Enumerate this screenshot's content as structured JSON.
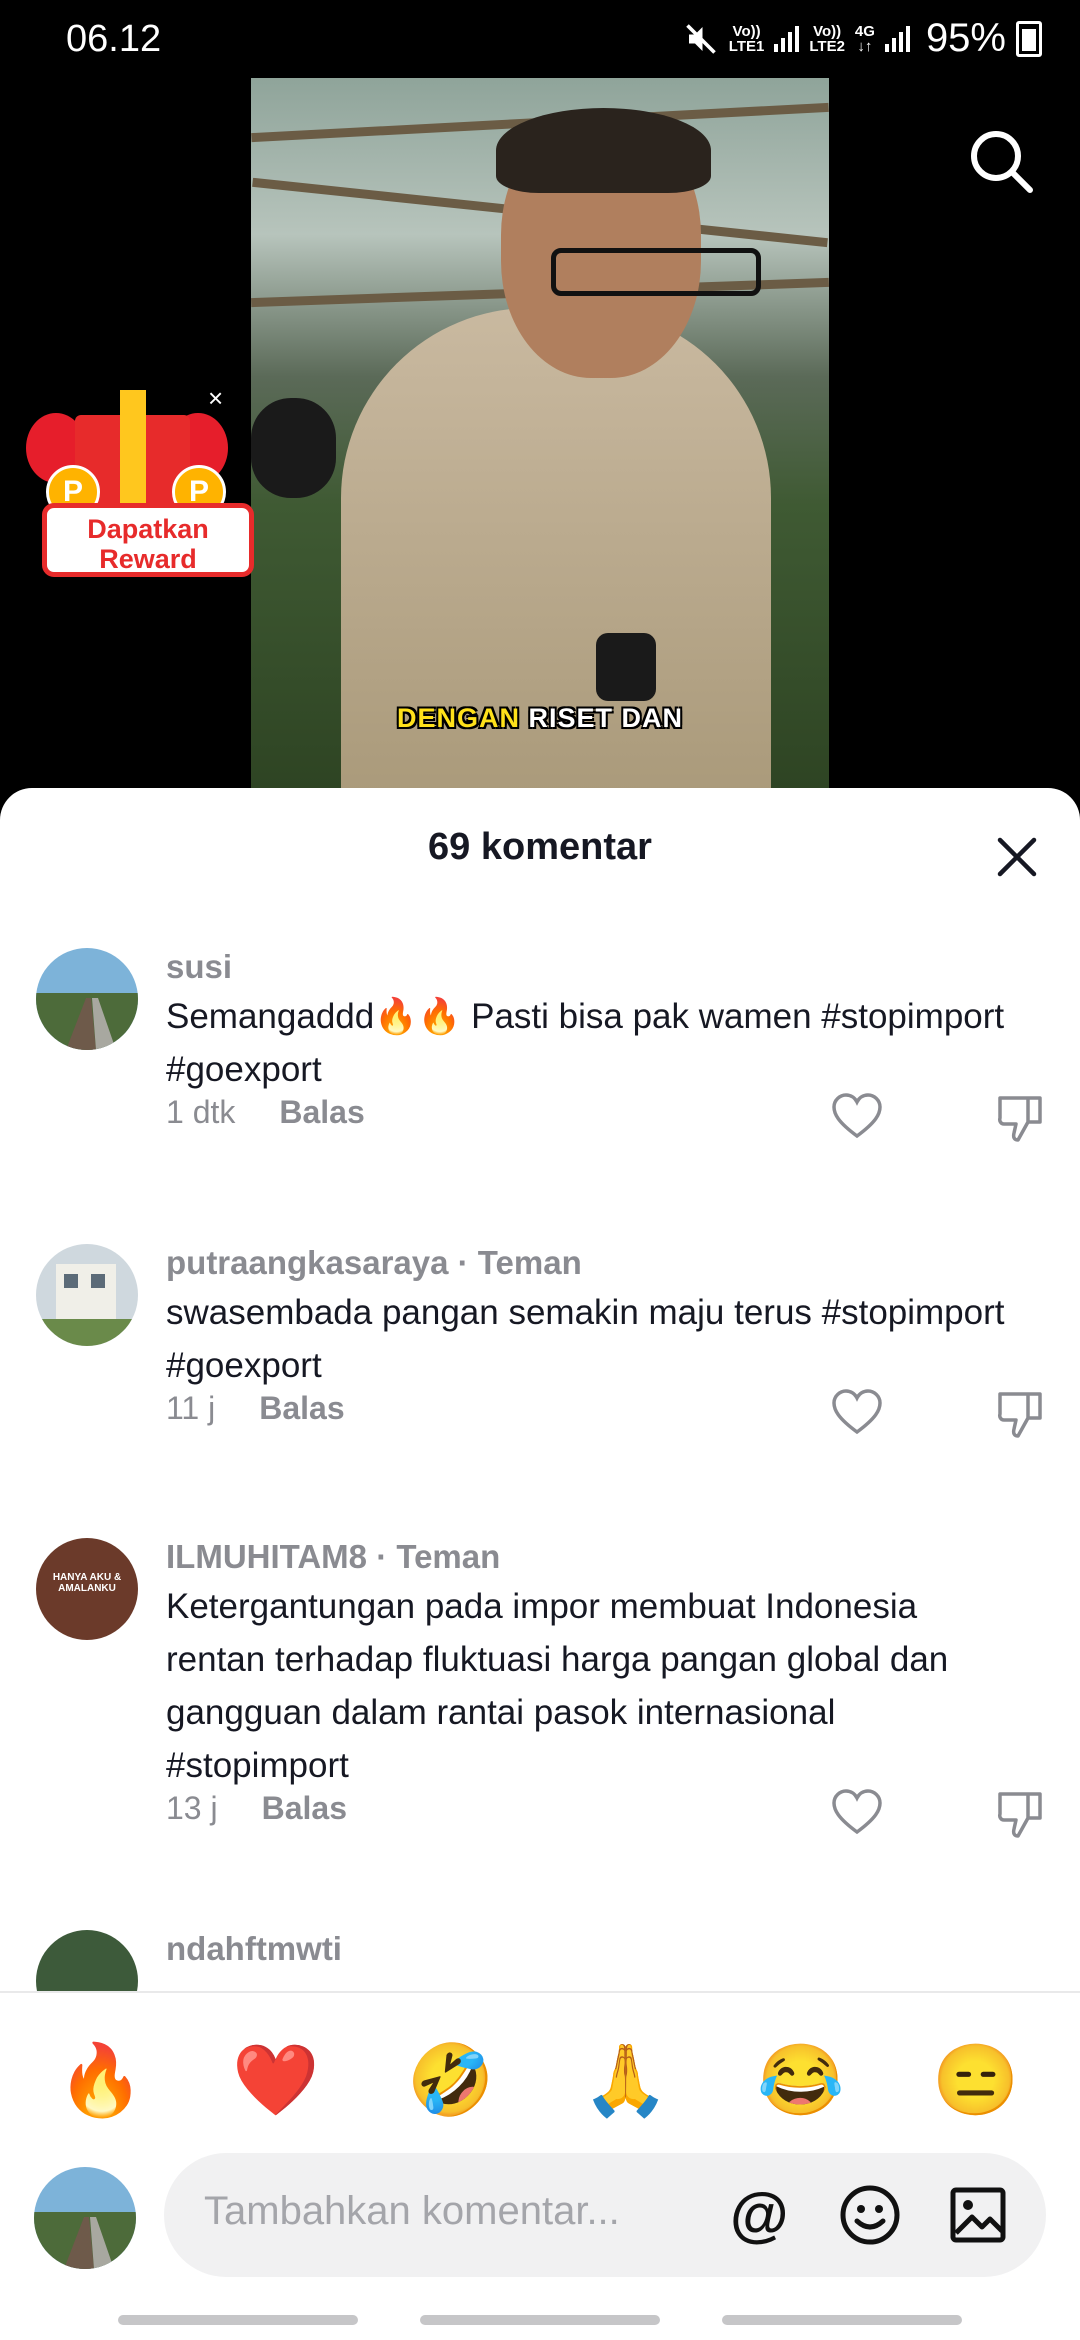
{
  "status_bar": {
    "time": "06.12",
    "sim1": "LTE1",
    "sim2": "LTE2",
    "net": "4G",
    "battery": "95%"
  },
  "video": {
    "caption_highlight": "DENGAN",
    "caption_rest": "RISET DAN"
  },
  "reward": {
    "label_line1": "Dapatkan",
    "label_line2": "Reward",
    "close": "×",
    "coin": "P"
  },
  "comments_panel": {
    "title": "69 komentar",
    "comments": [
      {
        "user": "susi",
        "badge": "",
        "text": "Semangaddd🔥🔥 Pasti bisa pak wamen #stopimport #goexport",
        "time": "1 dtk",
        "reply": "Balas"
      },
      {
        "user": "putraangkasaraya",
        "badge": " · Teman",
        "text": "swasembada pangan semakin maju terus #stopimport #goexport",
        "time": "11 j",
        "reply": "Balas"
      },
      {
        "user": "ILMUHITAM8",
        "badge": " · Teman",
        "text": "Ketergantungan pada impor membuat Indonesia rentan terhadap fluktuasi harga pangan global dan gangguan dalam rantai pasok internasional #stopimport",
        "time": "13 j",
        "reply": "Balas",
        "avatar_text": "HANYA AKU & AMALANKU"
      },
      {
        "user": "ndahftmwti",
        "badge": "",
        "text": "",
        "time": "",
        "reply": ""
      }
    ]
  },
  "quick_emojis": [
    "🔥",
    "❤️",
    "🤣",
    "🙏",
    "😂",
    "😑"
  ],
  "input": {
    "placeholder": "Tambahkan komentar...",
    "at_symbol": "@"
  },
  "colors": {
    "text": "#161823",
    "secondary": "#8a8b91",
    "reward_red": "#e72b2b"
  }
}
